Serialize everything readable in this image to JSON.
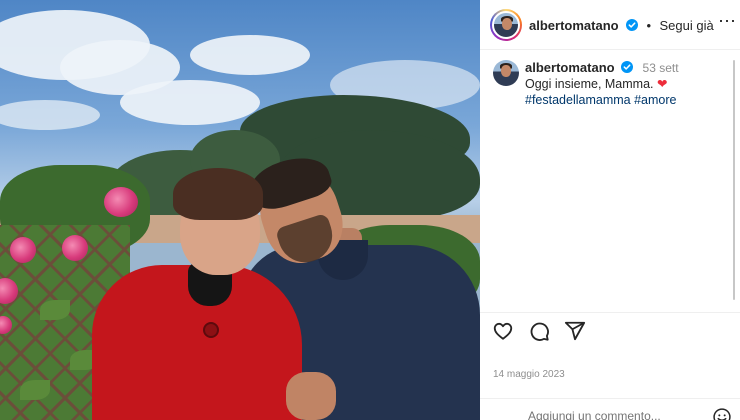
{
  "post": {
    "image_alt": "",
    "author": {
      "username": "albertomatano",
      "verified": true
    },
    "header": {
      "separator": "•",
      "follow_status": "Segui già",
      "more_icon": "more-horizontal-icon"
    },
    "caption": {
      "username": "albertomatano",
      "time_ago": "53 sett",
      "text": "Oggi insieme, Mamma.",
      "emoji": "❤",
      "hashtags": [
        "#festadellamamma",
        "#amore"
      ]
    },
    "actions": [
      "heart-icon",
      "comment-icon",
      "share-icon"
    ],
    "date": "14 maggio 2023",
    "add_comment": {
      "placeholder": "Aggiungi un commento..."
    }
  },
  "colors": {
    "link": "#00376b",
    "verified": "#0095f6",
    "heart": "#ed2d3b",
    "muted": "#8e8e8e"
  }
}
